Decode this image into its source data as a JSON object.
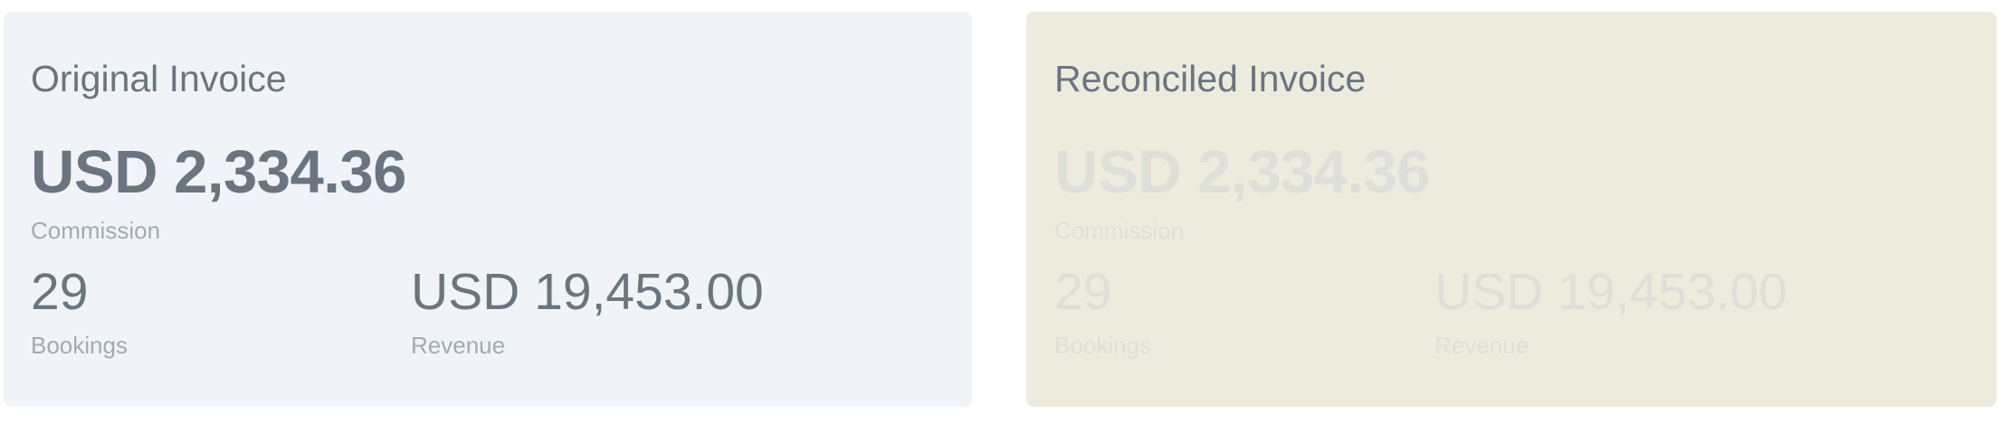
{
  "original_invoice": {
    "title": "Original Invoice",
    "commission_value": "USD 2,334.36",
    "commission_label": "Commission",
    "bookings_value": "29",
    "bookings_label": "Bookings",
    "revenue_value": "USD 19,453.00",
    "revenue_label": "Revenue"
  },
  "reconciled_invoice": {
    "title": "Reconciled Invoice",
    "commission_value": "USD 2,334.36",
    "commission_label": "Commission",
    "bookings_value": "29",
    "bookings_label": "Bookings",
    "revenue_value": "USD 19,453.00",
    "revenue_label": "Revenue"
  },
  "colors": {
    "original_card_bg": "#f0f4f9",
    "reconciled_card_bg": "#ecebde",
    "text_primary": "#6a7580",
    "text_secondary": "#a3aab2",
    "text_faded": "#dedfd8"
  }
}
